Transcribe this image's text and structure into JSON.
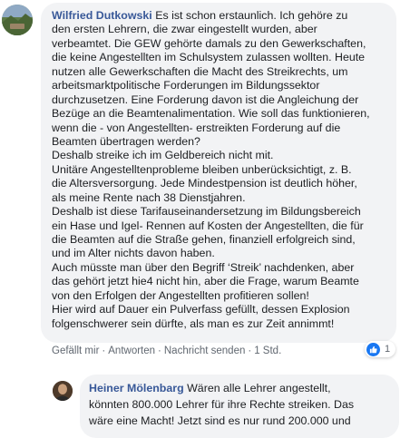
{
  "comment": {
    "author": "Wilfried Dutkowski",
    "first_line": "Es ist schon erstaunlich. Ich gehöre zu",
    "lines": [
      "den ersten Lehrern, die zwar eingestellt wurden, aber",
      "verbeamtet. Die GEW gehörte damals zu den Gewerkschaften,",
      "die keine Angestellten im Schulsystem zulassen wollten. Heute",
      "nutzen alle Gewerkschaften die Macht des Streikrechts, um",
      "arbeitsmarktpolitische Forderungen im Bildungssektor",
      "durchzusetzen. Eine Forderung davon ist die Angleichung der",
      "Bezüge an die Beamtenalimentation. Wie soll das funktionieren,",
      "wenn die - von Angestellten- erstreikten Forderung auf die",
      "Beamten übertragen werden?",
      "Deshalb streike ich im Geldbereich nicht mit.",
      "Unitäre Angestelltenprobleme bleiben unberücksichtigt, z. B.",
      "die Altersversorgung. Jede Mindestpension ist deutlich höher,",
      "als meine Rente nach 38 Dienstjahren.",
      "Deshalb ist diese Tarifauseinandersetzung im Bildungsbereich",
      "ein Hase und Igel- Rennen auf Kosten der Angestellten, die für",
      "die Beamten auf die Straße gehen, finanziell erfolgreich sind,",
      "und im Alter nichts davon haben.",
      "Auch müsste man über den Begriff ‘Streik’ nachdenken, aber",
      "das gehört jetzt hie4 nicht hin, aber die Frage, warum Beamte",
      "von den Erfolgen der Angestellten profitieren sollen!",
      "Hier wird auf Dauer ein Pulverfass gefüllt, dessen Explosion",
      "folgenschwerer sein dürfte, als man es zur Zeit annimmt!"
    ],
    "actions": {
      "like": "Gefällt mir",
      "reply": "Antworten",
      "message": "Nachricht senden",
      "time": "1 Std.",
      "separator": "·"
    },
    "reaction_count": "1"
  },
  "reply": {
    "author": "Heiner Mölenbarg",
    "first_line": "Wären alle Lehrer angestellt,",
    "lines": [
      "könnten 800.000 Lehrer für ihre Rechte streiken. Das",
      "wäre eine Macht! Jetzt sind es nur rund 200.000 und"
    ]
  },
  "colors": {
    "author_link": "#385898",
    "bubble_bg": "#f2f3f5",
    "like_blue": "#1877f2",
    "meta_gray": "#606770"
  }
}
